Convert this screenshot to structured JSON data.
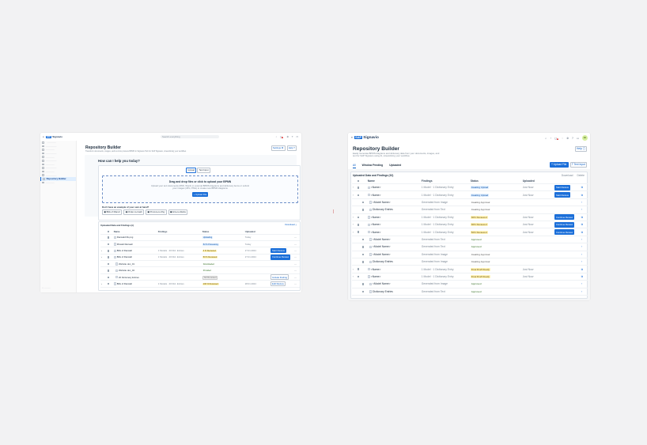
{
  "app": {
    "brand": "SAP",
    "product": "Signavio"
  },
  "left": {
    "search_placeholder": "Search everything",
    "sidebar": [
      "",
      "",
      "",
      "",
      "",
      "",
      "",
      "",
      "",
      "",
      ""
    ],
    "sidebar_selected": "Repository Builder",
    "title": "Repository Builder",
    "subtitle": "Transform documents, images, and text into process BPMN in Signavio Hub for SAP Signavio, streamlining your workflow.",
    "btn_settings": "Settings",
    "btn_help": "Help",
    "prompt_title": "How can I help you today?",
    "tab_upload": "Upload",
    "tab_text": "Text Input",
    "drop_title": "Drag and drop files or click to upload your BPMN",
    "drop_desc": "Upload your text documents (PDF, Word) or external BPMN diagrams and dictionary items or submit your images (JPG, PNG) to create new BPMN diagrams",
    "drop_btn": "Upload File",
    "samples_title": "Don't have an example of your own at hand?",
    "samples": [
      "Bills of Manuf.",
      "Order-to-Cash",
      "Procure-to-Pay",
      "Hire-to-Retire"
    ],
    "table_title": "Uploaded Data and Findings (n)",
    "table_action": "Download",
    "headers": [
      "Name",
      "Findings",
      "Status",
      "Uploaded"
    ],
    "rows": [
      {
        "name": "Ranwald Dk.png",
        "findings": "",
        "status": "Uploading",
        "status_type": "up",
        "uploaded": "Today",
        "action": ""
      },
      {
        "name": "Mrwald Ranwall",
        "findings": "",
        "status": "52 % Processing",
        "status_type": "pr",
        "uploaded": "Today",
        "action": ""
      },
      {
        "name": "Bills of Ranwall",
        "findings": "1 Models · 20 Dict. Entries",
        "status": "3 % Reviewed",
        "status_type": "rv",
        "uploaded": "27.01.2024",
        "action": "Start Review"
      },
      {
        "name": "Bills of Ranwall",
        "findings": "1 Models · 20 Dict. Entries",
        "status": "50 % Reviewed",
        "status_type": "rv",
        "uploaded": "27.01.2024",
        "action": "Continue Review"
      },
      {
        "name": "Website doc_01",
        "findings": "",
        "status": "Downloaded",
        "status_type": "dn",
        "uploaded": "",
        "action": ""
      },
      {
        "name": "Website doc_02",
        "findings": "",
        "status": "Provided",
        "status_type": "dn",
        "uploaded": "",
        "action": ""
      },
      {
        "name": "20 Dictionary Entries",
        "findings": "",
        "status": "Not Reviewed",
        "status_type": "ns",
        "uploaded": "",
        "action": "Include Finding"
      },
      {
        "name": "Bills of Ranwall",
        "findings": "1 Models · 20 Dict. Entries",
        "status": "100 % Reviewed",
        "status_type": "rv",
        "uploaded": "28.01.2024",
        "action": "Edit Review"
      }
    ]
  },
  "right": {
    "title": "Repository Builder",
    "subtitle": "Easily Generate BPMN diagrams and dictionary data from your documents, images, and text for SAP Signavio using AI, streamlining your workflow.",
    "btn_help": "Help",
    "tabs": [
      "All",
      "Window Pending",
      "Uploaded"
    ],
    "btn_upload": "Upload File",
    "btn_text": "Text Input",
    "table_title": "Uploaded Data and Findings (32)",
    "table_actions": [
      "Download",
      "Delete"
    ],
    "headers": [
      "Name",
      "Findings",
      "Status",
      "Uploaded"
    ],
    "rows": [
      {
        "level": 0,
        "name": "<Name>",
        "findings": "1 Model · 1 Dictionary Entry",
        "status": "Awaiting Upload",
        "status_type": "up",
        "uploaded": "Just Now",
        "action": "Start Review"
      },
      {
        "level": 0,
        "name": "<Name>",
        "findings": "1 Model · 1 Dictionary Entry",
        "status": "Awaiting Upload",
        "status_type": "up",
        "uploaded": "Just Now",
        "action": "Start Review"
      },
      {
        "level": 1,
        "name": "<Model Name>",
        "findings": "Generated from Image",
        "status": "Awaiting Approval",
        "status_type": "aw",
        "uploaded": "",
        "action": ""
      },
      {
        "level": 1,
        "name": "Dictionary Entries",
        "findings": "Generated from Text",
        "status": "Awaiting Approval",
        "status_type": "aw",
        "uploaded": "",
        "action": ""
      },
      {
        "level": 0,
        "name": "<Name>",
        "findings": "1 Model · 1 Dictionary Entry",
        "status": "30% Reviewed",
        "status_type": "rv",
        "uploaded": "Just Now",
        "action": "Continue Review"
      },
      {
        "level": 0,
        "name": "<Name>",
        "findings": "1 Model · 1 Dictionary Entry",
        "status": "30% Reviewed",
        "status_type": "rv",
        "uploaded": "Just Now",
        "action": "Continue Review"
      },
      {
        "level": 0,
        "name": "<Name>",
        "findings": "1 Model · 1 Dictionary Entry",
        "status": "50% Reviewed",
        "status_type": "rv",
        "uploaded": "Just Now",
        "action": "Continue Review"
      },
      {
        "level": 1,
        "name": "<Model Name>",
        "findings": "Generated from Text",
        "status": "Approved",
        "status_type": "ap",
        "uploaded": "",
        "action": ""
      },
      {
        "level": 1,
        "name": "<Model Name>",
        "findings": "Generated from Text",
        "status": "Approved",
        "status_type": "ap",
        "uploaded": "",
        "action": ""
      },
      {
        "level": 1,
        "name": "<Model Name>",
        "findings": "Generated from Image",
        "status": "Awaiting Approval",
        "status_type": "aw",
        "uploaded": "",
        "action": ""
      },
      {
        "level": 1,
        "name": "Dictionary Entries",
        "findings": "Generated from Image",
        "status": "Awaiting Approval",
        "status_type": "aw",
        "uploaded": "",
        "action": ""
      },
      {
        "level": 0,
        "name": "<Name>",
        "findings": "1 Model · 1 Dictionary Entry",
        "status": "Final Draft Ready",
        "status_type": "rv",
        "uploaded": "Just Now",
        "action": ""
      },
      {
        "level": 0,
        "name": "<Name>",
        "findings": "1 Model · 1 Dictionary Entry",
        "status": "Final Draft Ready",
        "status_type": "rv",
        "uploaded": "Just Now",
        "action": ""
      },
      {
        "level": 1,
        "name": "<Model Name>",
        "findings": "Generated from Image",
        "status": "Approved",
        "status_type": "ap",
        "uploaded": "",
        "action": ""
      },
      {
        "level": 1,
        "name": "Dictionary Entries",
        "findings": "Generated from Text",
        "status": "Approved",
        "status_type": "ap",
        "uploaded": "",
        "action": ""
      }
    ]
  }
}
